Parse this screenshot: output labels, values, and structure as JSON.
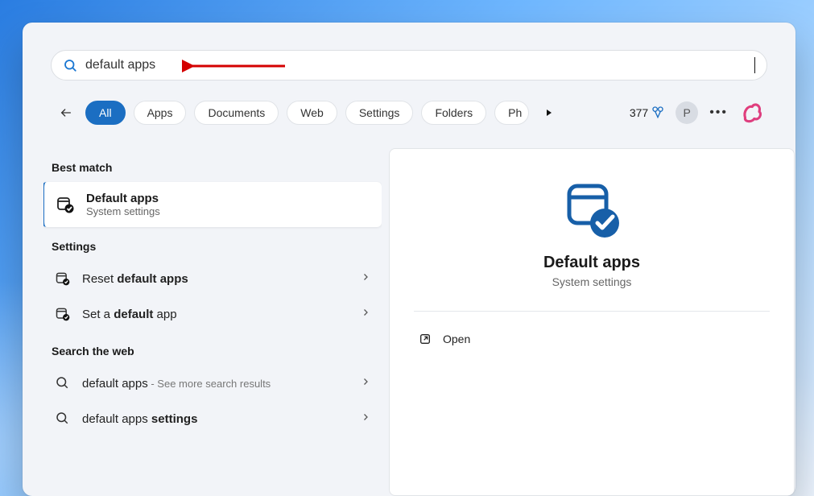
{
  "search": {
    "query": "default apps"
  },
  "filters": {
    "items": [
      {
        "label": "All",
        "active": true
      },
      {
        "label": "Apps",
        "active": false
      },
      {
        "label": "Documents",
        "active": false
      },
      {
        "label": "Web",
        "active": false
      },
      {
        "label": "Settings",
        "active": false
      },
      {
        "label": "Folders",
        "active": false
      },
      {
        "label": "Ph",
        "active": false
      }
    ]
  },
  "rewards": {
    "points": "377"
  },
  "profile": {
    "initial": "P"
  },
  "sections": {
    "best_match_heading": "Best match",
    "settings_heading": "Settings",
    "web_heading": "Search the web"
  },
  "best_match": {
    "title": "Default apps",
    "subtitle": "System settings"
  },
  "settings_results": [
    {
      "prefix": "Reset ",
      "bold": "default apps",
      "suffix": ""
    },
    {
      "prefix": "Set a ",
      "bold": "default",
      "suffix": " app"
    }
  ],
  "web_results": [
    {
      "text": "default apps",
      "hint": " - See more search results"
    },
    {
      "text_prefix": "default apps ",
      "text_bold": "settings",
      "hint": ""
    }
  ],
  "details": {
    "title": "Default apps",
    "subtitle": "System settings",
    "open_label": "Open"
  },
  "colors": {
    "accent": "#1b6ec2"
  }
}
